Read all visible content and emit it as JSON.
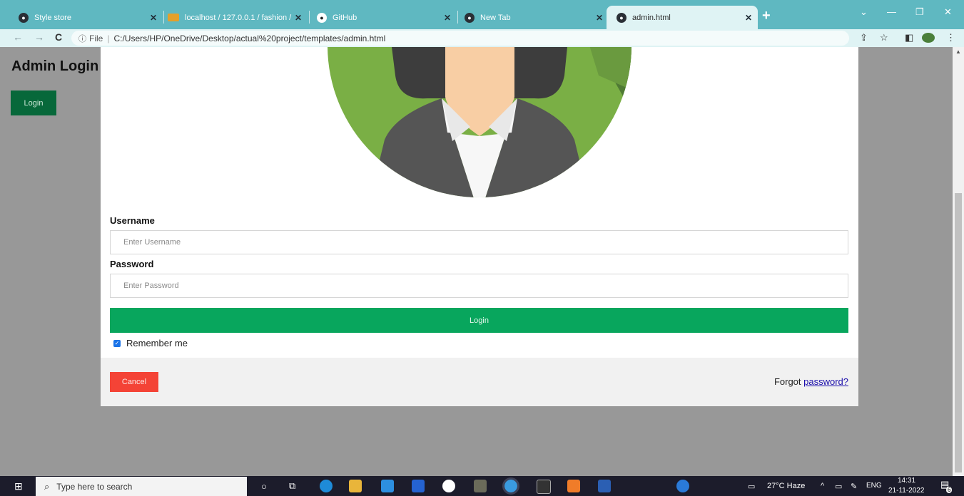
{
  "browser": {
    "tabs": [
      {
        "title": "Style store",
        "active": false
      },
      {
        "title": "localhost / 127.0.0.1 / fashion / ...",
        "active": false
      },
      {
        "title": "GitHub",
        "active": false
      },
      {
        "title": "New Tab",
        "active": false
      },
      {
        "title": "admin.html",
        "active": true
      }
    ],
    "new_tab_glyph": "+",
    "window_controls": {
      "chevron": "⌄",
      "minimize": "—",
      "restore": "❐",
      "close": "✕"
    },
    "nav": {
      "back": "←",
      "forward": "→",
      "reload": "C"
    },
    "address": {
      "info_icon": "ⓘ",
      "scheme": "File",
      "url": "C:/Users/HP/OneDrive/Desktop/actual%20project/templates/admin.html"
    },
    "toolbar_icons": [
      "share-icon",
      "star-icon",
      "sidepanel-icon",
      "profile-icon",
      "menu-icon"
    ]
  },
  "page": {
    "title": "Admin Login",
    "login_button": "Login"
  },
  "modal": {
    "username_label": "Username",
    "username_placeholder": "Enter Username",
    "password_label": "Password",
    "password_placeholder": "Enter Password",
    "submit_label": "Login",
    "remember_label": "Remember me",
    "remember_checked": true,
    "cancel_label": "Cancel",
    "forgot_text": "Forgot ",
    "forgot_link": "password?"
  },
  "colors": {
    "page_bg": "#989898",
    "submit_green": "#08a65d",
    "page_login_green": "#07683a",
    "cancel_red": "#f44336",
    "tabbar": "#5fb8c1"
  },
  "taskbar": {
    "search_placeholder": "Type here to search",
    "weather": "27°C  Haze",
    "language": "ENG",
    "time": "14:31",
    "date": "21-11-2022",
    "notifications": "6"
  }
}
